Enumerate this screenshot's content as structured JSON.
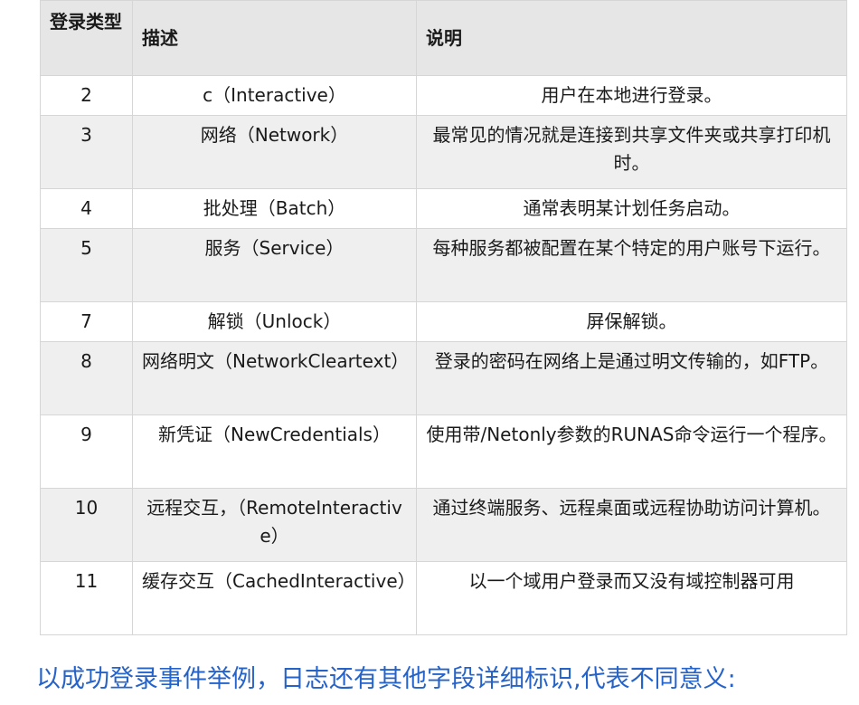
{
  "table": {
    "headers": {
      "type": "登录类型",
      "description": "描述",
      "note": "说明"
    },
    "rows": [
      {
        "type": "2",
        "description": "c（Interactive）",
        "note": "用户在本地进行登录。"
      },
      {
        "type": "3",
        "description": "网络（Network）",
        "note": "最常见的情况就是连接到共享文件夹或共享打印机时。"
      },
      {
        "type": "4",
        "description": "批处理（Batch）",
        "note": "通常表明某计划任务启动。"
      },
      {
        "type": "5",
        "description": "服务（Service）",
        "note": "每种服务都被配置在某个特定的用户账号下运行。"
      },
      {
        "type": "7",
        "description": "解锁（Unlock）",
        "note": "屏保解锁。"
      },
      {
        "type": "8",
        "description": "网络明文（NetworkCleartext）",
        "note": "登录的密码在网络上是通过明文传输的，如FTP。"
      },
      {
        "type": "9",
        "description": "新凭证（NewCredentials）",
        "note": "使用带/Netonly参数的RUNAS命令运行一个程序。"
      },
      {
        "type": "10",
        "description": "远程交互，（RemoteInteractive）",
        "note": "通过终端服务、远程桌面或远程协助访问计算机。"
      },
      {
        "type": "11",
        "description": "缓存交互（CachedInteractive）",
        "note": "以一个域用户登录而又没有域控制器可用"
      }
    ]
  },
  "caption": "以成功登录事件举例，日志还有其他字段详细标识,代表不同意义:"
}
